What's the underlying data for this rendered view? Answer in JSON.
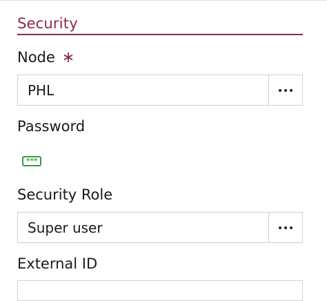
{
  "section": {
    "title": "Security"
  },
  "fields": {
    "node": {
      "label": "Node",
      "required_mark": "∗",
      "value": "PHL"
    },
    "password": {
      "label": "Password",
      "icon_glyph": "***"
    },
    "security_role": {
      "label": "Security Role",
      "value": "Super user"
    },
    "external_id": {
      "label": "External ID",
      "value": ""
    }
  },
  "colors": {
    "accent": "#8a2b47",
    "password_icon": "#3c9a3c",
    "border": "#cfcfcf"
  },
  "icons": {
    "lookup_button": "more-dots-icon",
    "password": "password-masked-icon"
  }
}
